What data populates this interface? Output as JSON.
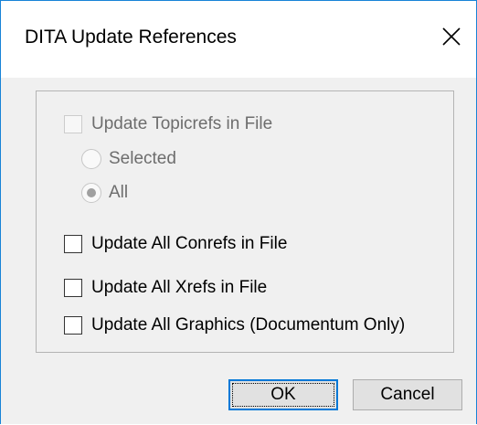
{
  "dialog": {
    "title": "DITA Update References",
    "close_icon": "close-icon"
  },
  "options": {
    "topicrefs": {
      "label": "Update Topicrefs in File",
      "checked": false,
      "enabled": false
    },
    "radio_selected": {
      "label": "Selected",
      "checked": false,
      "enabled": false
    },
    "radio_all": {
      "label": "All",
      "checked": true,
      "enabled": false
    },
    "conrefs": {
      "label": "Update All Conrefs in File",
      "checked": false,
      "enabled": true
    },
    "xrefs": {
      "label": "Update All Xrefs in File",
      "checked": false,
      "enabled": true
    },
    "graphics": {
      "label": "Update All Graphics (Documentum Only)",
      "checked": false,
      "enabled": true
    }
  },
  "buttons": {
    "ok_label": "OK",
    "cancel_label": "Cancel"
  },
  "colors": {
    "window_border": "#1883d7",
    "default_button_border": "#0078d7"
  }
}
